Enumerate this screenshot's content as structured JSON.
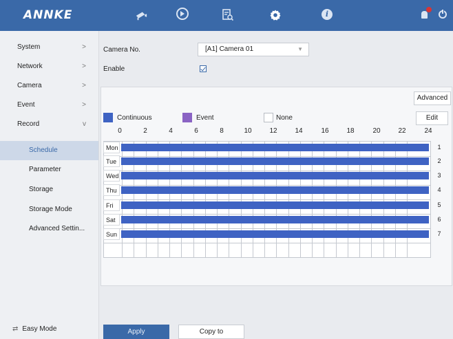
{
  "brand": "ANNKE",
  "topbar": {
    "icons": [
      "camera-icon",
      "playback-icon",
      "search-icon",
      "settings-icon",
      "info-icon",
      "alarm-bell-icon",
      "power-icon"
    ],
    "active": "settings-icon"
  },
  "sidebar": {
    "items": [
      {
        "label": "System",
        "chevron": ">"
      },
      {
        "label": "Network",
        "chevron": ">"
      },
      {
        "label": "Camera",
        "chevron": ">"
      },
      {
        "label": "Event",
        "chevron": ">"
      },
      {
        "label": "Record",
        "chevron": "v"
      }
    ],
    "sub_items": [
      {
        "label": "Schedule",
        "selected": true
      },
      {
        "label": "Parameter",
        "selected": false
      },
      {
        "label": "Storage",
        "selected": false
      },
      {
        "label": "Storage Mode",
        "selected": false
      },
      {
        "label": "Advanced Settin...",
        "selected": false
      }
    ],
    "easy_mode": "Easy Mode"
  },
  "form": {
    "camera_no_label": "Camera No.",
    "camera_no_value": "[A1] Camera 01",
    "enable_label": "Enable",
    "enable_checked": true
  },
  "schedule": {
    "advanced_label": "Advanced",
    "edit_label": "Edit",
    "legend": [
      {
        "label": "Continuous",
        "color": "#3f63c3"
      },
      {
        "label": "Event",
        "color": "#8a63c4"
      },
      {
        "label": "None",
        "color": "#ffffff"
      }
    ],
    "hours": [
      "0",
      "2",
      "4",
      "6",
      "8",
      "10",
      "12",
      "14",
      "16",
      "18",
      "20",
      "22",
      "24"
    ],
    "days": [
      {
        "name": "Mon",
        "num": "1"
      },
      {
        "name": "Tue",
        "num": "2"
      },
      {
        "name": "Wed",
        "num": "3"
      },
      {
        "name": "Thu",
        "num": "4"
      },
      {
        "name": "Fri",
        "num": "5"
      },
      {
        "name": "Sat",
        "num": "6"
      },
      {
        "name": "Sun",
        "num": "7"
      }
    ]
  },
  "actions": {
    "apply_label": "Apply",
    "copy_label": "Copy to"
  }
}
